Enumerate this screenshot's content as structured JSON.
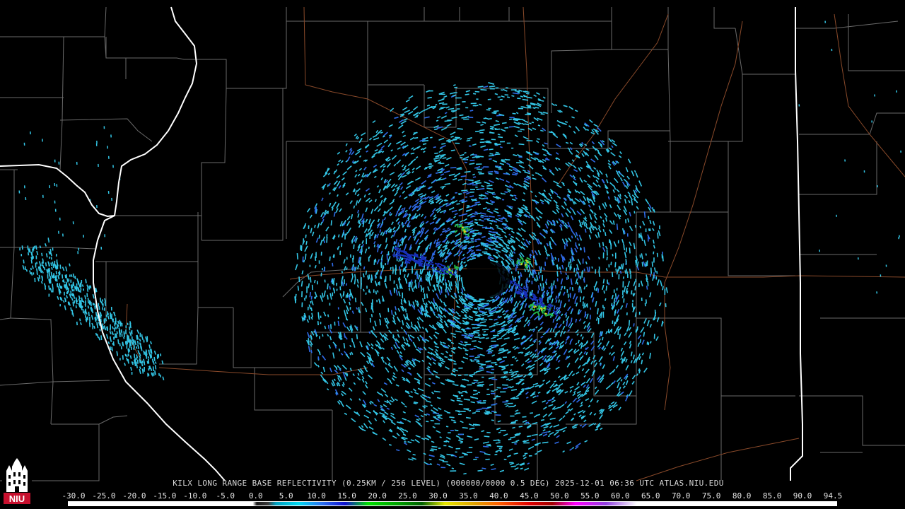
{
  "caption": "KILX LONG RANGE BASE REFLECTIVITY (0.25KM / 256 LEVEL) (000000/0000 0.5 DEG) 2025-12-01 06:36 UTC  ATLAS.NIU.EDU",
  "scale_labels": [
    "-30.0",
    "-25.0",
    "-20.0",
    "-15.0",
    "-10.0",
    "-5.0",
    "0.0",
    "5.0",
    "10.0",
    "15.0",
    "20.0",
    "25.0",
    "30.0",
    "35.0",
    "40.0",
    "45.0",
    "50.0",
    "55.0",
    "60.0",
    "65.0",
    "70.0",
    "75.0",
    "80.0",
    "85.0",
    "90.0",
    "94.5"
  ],
  "colors": {
    "background": "#000000",
    "county_lines": "#6a6a6a",
    "state_lines": "#ffffff",
    "roads": "#8a4a2a",
    "echo_light": "#33c6e6",
    "echo_mid": "#2f6be8",
    "echo_green": "#22b84a",
    "echo_yellow": "#d8d020"
  },
  "logo": {
    "text": "NIU",
    "color": "#c8102e"
  }
}
